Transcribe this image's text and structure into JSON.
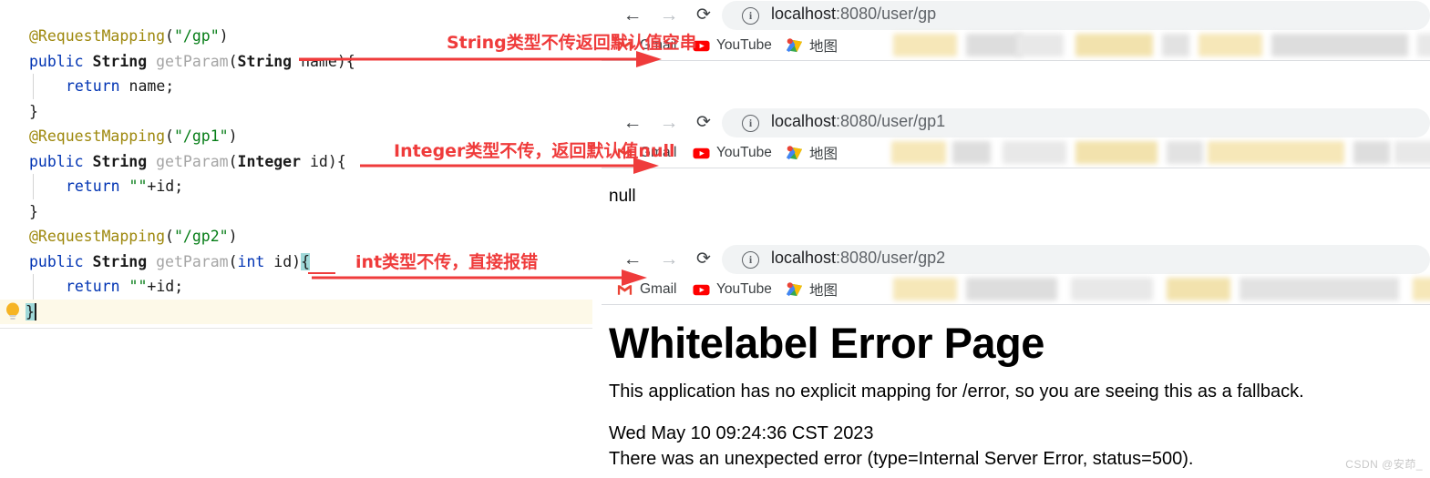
{
  "ide": {
    "lines": [
      {
        "indent": 0,
        "tokens": [
          {
            "t": "@RequestMapping",
            "c": "ann"
          },
          {
            "t": "(",
            "c": "punct"
          },
          {
            "t": "\"/gp\"",
            "c": "str"
          },
          {
            "t": ")",
            "c": "punct"
          }
        ]
      },
      {
        "indent": 0,
        "tokens": [
          {
            "t": "public ",
            "c": "kw"
          },
          {
            "t": "String ",
            "c": "type"
          },
          {
            "t": "getParam",
            "c": "method"
          },
          {
            "t": "(",
            "c": "punct"
          },
          {
            "t": "String ",
            "c": "type"
          },
          {
            "t": "name",
            "c": "plain"
          },
          {
            "t": "){",
            "c": "punct"
          }
        ]
      },
      {
        "indent": 1,
        "guide": true,
        "tokens": [
          {
            "t": "return ",
            "c": "kw"
          },
          {
            "t": "name;",
            "c": "plain"
          }
        ]
      },
      {
        "indent": 0,
        "tokens": [
          {
            "t": "}",
            "c": "punct"
          }
        ]
      },
      {
        "indent": 0,
        "tokens": [
          {
            "t": "@RequestMapping",
            "c": "ann"
          },
          {
            "t": "(",
            "c": "punct"
          },
          {
            "t": "\"/gp1\"",
            "c": "str"
          },
          {
            "t": ")",
            "c": "punct"
          }
        ]
      },
      {
        "indent": 0,
        "tokens": [
          {
            "t": "public ",
            "c": "kw"
          },
          {
            "t": "String ",
            "c": "type"
          },
          {
            "t": "getParam",
            "c": "method"
          },
          {
            "t": "(",
            "c": "punct"
          },
          {
            "t": "Integer ",
            "c": "type"
          },
          {
            "t": "id",
            "c": "plain"
          },
          {
            "t": "){",
            "c": "punct"
          }
        ]
      },
      {
        "indent": 1,
        "guide": true,
        "tokens": [
          {
            "t": "return ",
            "c": "kw"
          },
          {
            "t": "\"\"",
            "c": "str"
          },
          {
            "t": "+id;",
            "c": "plain"
          }
        ]
      },
      {
        "indent": 0,
        "tokens": [
          {
            "t": "}",
            "c": "punct"
          }
        ]
      },
      {
        "indent": 0,
        "tokens": [
          {
            "t": "@RequestMapping",
            "c": "ann"
          },
          {
            "t": "(",
            "c": "punct"
          },
          {
            "t": "\"/gp2\"",
            "c": "str"
          },
          {
            "t": ")",
            "c": "punct"
          }
        ]
      },
      {
        "indent": 0,
        "tokens": [
          {
            "t": "public ",
            "c": "kw"
          },
          {
            "t": "String ",
            "c": "type"
          },
          {
            "t": "getParam",
            "c": "method"
          },
          {
            "t": "(",
            "c": "punct"
          },
          {
            "t": "int ",
            "c": "kw"
          },
          {
            "t": "id",
            "c": "plain"
          },
          {
            "t": ")",
            "c": "punct"
          },
          {
            "t": "{",
            "c": "brace-hl"
          }
        ]
      },
      {
        "indent": 1,
        "guide": true,
        "tokens": [
          {
            "t": "return ",
            "c": "kw"
          },
          {
            "t": "\"\"",
            "c": "str"
          },
          {
            "t": "+id;",
            "c": "plain"
          }
        ]
      },
      {
        "indent": 0,
        "last": true,
        "caret": true,
        "tokens": [
          {
            "t": "}",
            "c": "brace-hl"
          }
        ]
      }
    ],
    "bulb_icon": "lightbulb-icon"
  },
  "annotations": [
    {
      "text": "String类型不传返回默认值空串"
    },
    {
      "text": "Integer类型不传，返回默认值null"
    },
    {
      "text": "int类型不传，直接报错"
    }
  ],
  "browsers": [
    {
      "nav": {
        "back": "←",
        "forward": "→",
        "reload": "⟳",
        "info": "i"
      },
      "url_host": "localhost",
      "url_path": ":8080/user/gp",
      "bookmarks": [
        {
          "label": "Gmail",
          "icon": "gmail-icon"
        },
        {
          "label": "YouTube",
          "icon": "youtube-icon"
        },
        {
          "label": "地图",
          "icon": "google-maps-icon"
        }
      ],
      "body_text": ""
    },
    {
      "nav": {
        "back": "←",
        "forward": "→",
        "reload": "⟳",
        "info": "i"
      },
      "url_host": "localhost",
      "url_path": ":8080/user/gp1",
      "bookmarks": [
        {
          "label": "Gmail",
          "icon": "gmail-icon"
        },
        {
          "label": "YouTube",
          "icon": "youtube-icon"
        },
        {
          "label": "地图",
          "icon": "google-maps-icon"
        }
      ],
      "body_text": "null"
    },
    {
      "nav": {
        "back": "←",
        "forward": "→",
        "reload": "⟳",
        "info": "i"
      },
      "url_host": "localhost",
      "url_path": ":8080/user/gp2",
      "bookmarks": [
        {
          "label": "Gmail",
          "icon": "gmail-icon"
        },
        {
          "label": "YouTube",
          "icon": "youtube-icon"
        },
        {
          "label": "地图",
          "icon": "google-maps-icon"
        }
      ],
      "error_page": {
        "title": "Whitelabel Error Page",
        "paragraph": "This application has no explicit mapping for /error, so you are seeing this as a fallback.",
        "timestamp": "Wed May 10 09:24:36 CST 2023",
        "detail": "There was an unexpected error (type=Internal Server Error, status=500)."
      }
    }
  ],
  "watermark": "CSDN @安茚_",
  "colors": {
    "annotation_red": "#ef3b3b",
    "keyword_blue": "#0033b3",
    "string_green": "#067d17",
    "annotation_gold": "#9e880d",
    "method_gray": "#a5a5a5",
    "brace_highlight": "#9fd8d8",
    "omnibox_bg": "#f1f3f4"
  }
}
